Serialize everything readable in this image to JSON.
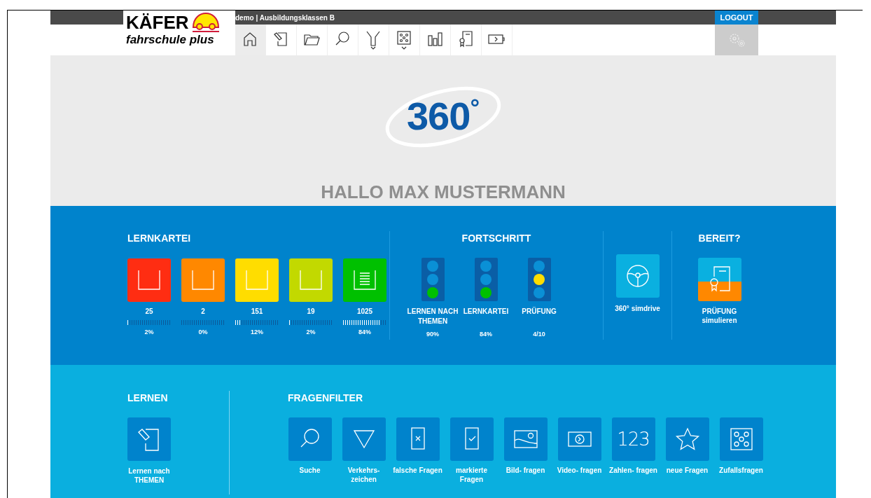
{
  "header": {
    "brand_top": "KÄFER",
    "brand_bottom": "fahrschule plus",
    "user_info": "demo | Ausbildungsklassen B",
    "logout": "LOGOUT"
  },
  "nav": [
    {
      "kind": "home",
      "selected": true
    },
    {
      "kind": "edit",
      "selected": false
    },
    {
      "kind": "folder",
      "selected": false
    },
    {
      "kind": "search",
      "selected": false
    },
    {
      "kind": "filter",
      "selected": false
    },
    {
      "kind": "dice",
      "selected": false
    },
    {
      "kind": "chart",
      "selected": false
    },
    {
      "kind": "certificate",
      "selected": false
    },
    {
      "kind": "video",
      "selected": false
    }
  ],
  "hero": {
    "logo_text": "360",
    "logo_degree": "°",
    "greeting": "HALLO MAX MUSTERMANN"
  },
  "lernkartei": {
    "title": "LERNKARTEI",
    "boxes": [
      {
        "color": "#ff2d12",
        "count": "25",
        "level": 0.02,
        "percent": "2%",
        "full": false
      },
      {
        "color": "#ff8800",
        "count": "2",
        "level": 0.0,
        "percent": "0%",
        "full": false
      },
      {
        "color": "#ffdd00",
        "count": "151",
        "level": 0.12,
        "percent": "12%",
        "full": false
      },
      {
        "color": "#c2d900",
        "count": "19",
        "level": 0.02,
        "percent": "2%",
        "full": false
      },
      {
        "color": "#00c000",
        "count": "1025",
        "level": 0.84,
        "percent": "84%",
        "full": true
      }
    ]
  },
  "fortschritt": {
    "title": "FORTSCHRITT",
    "lights": [
      {
        "lamps": [
          {
            "on": false
          },
          {
            "on": false
          },
          {
            "on": true
          }
        ],
        "color": "#00c000",
        "label": "LERNEN NACH THEMEN",
        "value": "90%"
      },
      {
        "lamps": [
          {
            "on": false
          },
          {
            "on": false
          },
          {
            "on": true
          }
        ],
        "color": "#00c000",
        "label": "LERNKARTEI",
        "value": "84%"
      },
      {
        "lamps": [
          {
            "on": false
          },
          {
            "on": true
          },
          {
            "on": false
          }
        ],
        "color": "#ffdd00",
        "label": "PRÜFUNG",
        "value": "4/10"
      }
    ]
  },
  "simdrive": {
    "label": "360° simdrive"
  },
  "bereit": {
    "title": "BEREIT?",
    "label": "PRÜFUNG simulieren"
  },
  "lernen": {
    "title": "LERNEN",
    "label": "Lernen nach THEMEN"
  },
  "fragenfilter": {
    "title": "FRAGENFILTER",
    "items": [
      {
        "kind": "search",
        "label": "Suche"
      },
      {
        "kind": "sign",
        "label": "Verkehrs- zeichen"
      },
      {
        "kind": "wrong",
        "label": "falsche Fragen"
      },
      {
        "kind": "marked",
        "label": "markierte Fragen"
      },
      {
        "kind": "image",
        "label": "Bild- fragen"
      },
      {
        "kind": "video",
        "label": "Video- fragen"
      },
      {
        "kind": "numbers",
        "label": "Zahlen- fragen",
        "glyph": "123"
      },
      {
        "kind": "star",
        "label": "neue Fragen"
      },
      {
        "kind": "dice",
        "label": "Zufallsfragen"
      }
    ]
  }
}
